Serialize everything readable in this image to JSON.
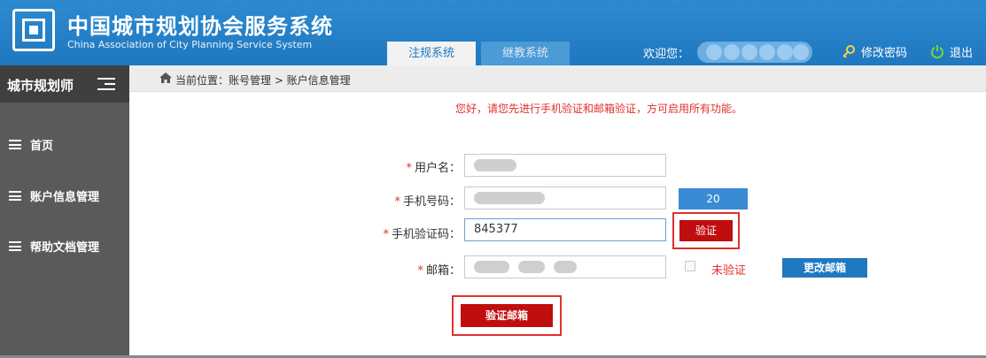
{
  "header": {
    "title_cn": "中国城市规划协会服务系统",
    "title_en": "China Association of City Planning Service System",
    "tabs": [
      {
        "label": "注规系统",
        "active": true
      },
      {
        "label": "继教系统",
        "active": false
      }
    ],
    "welcome": "欢迎您：",
    "change_password": "修改密码",
    "logout": "退出",
    "colors": {
      "brand": "#1f78c0",
      "header_top": "#2d8ad0"
    }
  },
  "sidebar": {
    "title": "城市规划师",
    "items": [
      {
        "label": "首页",
        "icon": "list-icon"
      },
      {
        "label": "账户信息管理",
        "icon": "list-icon"
      },
      {
        "label": "帮助文档管理",
        "icon": "list-icon"
      }
    ]
  },
  "breadcrumb": {
    "text": "当前位置：账号管理 > 账户信息管理"
  },
  "notice": "您好，请您先进行手机验证和邮箱验证，方可启用所有功能。",
  "form": {
    "username_label": "用户名：",
    "phone_label": "手机号码：",
    "code_label": "手机验证码：",
    "code_value": "845377",
    "email_label": "邮箱：",
    "countdown": "20",
    "verify_button": "验证",
    "unverified_text": "未验证",
    "change_email_button": "更改邮箱",
    "verify_email_button": "验证邮箱",
    "accent_red": "#e0302b"
  }
}
